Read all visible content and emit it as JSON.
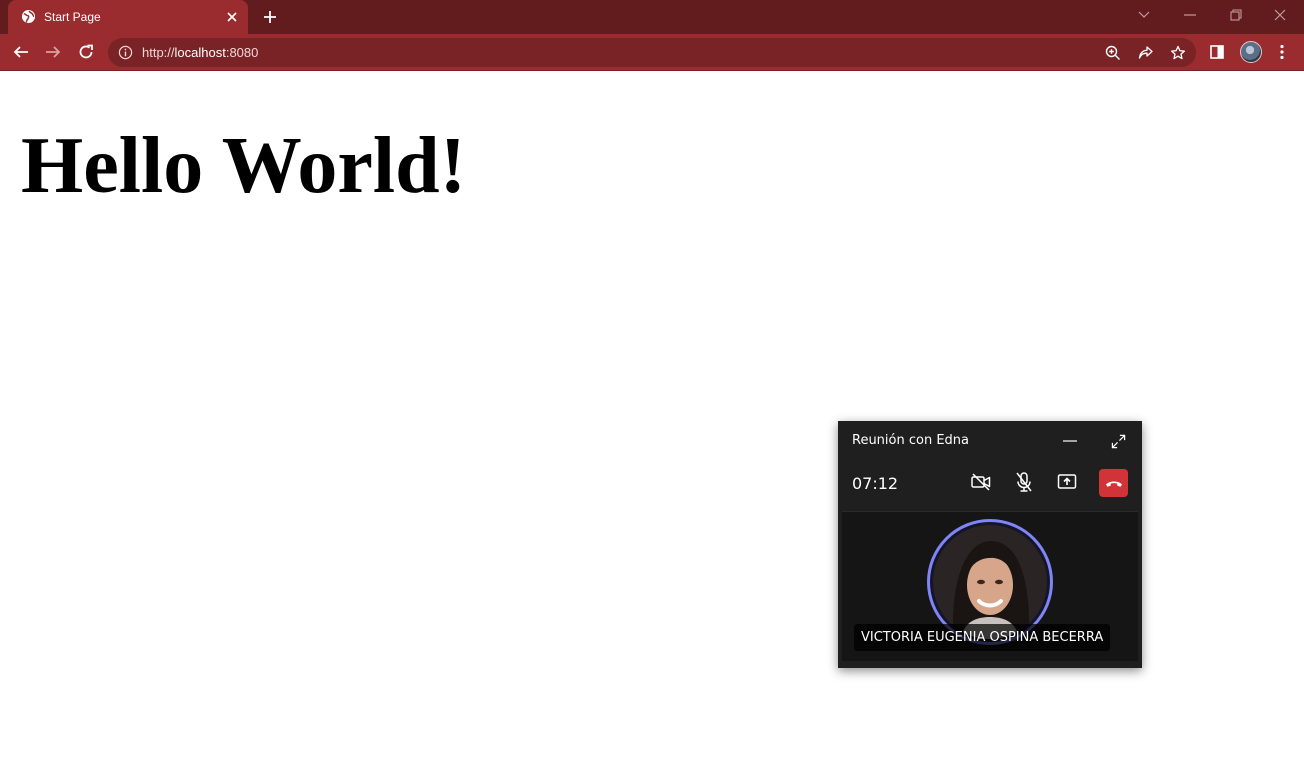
{
  "browser": {
    "tab": {
      "title": "Start Page"
    },
    "address": {
      "scheme": "http://",
      "host": "localhost",
      "port": ":8080"
    }
  },
  "page": {
    "heading": "Hello World!"
  },
  "call": {
    "title": "Reunión con Edna",
    "timer": "07:12",
    "participant": {
      "name": "VICTORIA EUGENIA OSPINA BECERRA"
    }
  },
  "colors": {
    "chrome_frame": "#631c1e",
    "chrome_toolbar": "#9a2b2f",
    "omnibox": "#7a2326",
    "call_background": "#1f1f1f",
    "hangup": "#d13438",
    "speaker_ring": "#7f85f5"
  },
  "icons": {
    "tab_favicon": "globe-icon",
    "tab_close": "close-icon",
    "new_tab": "plus-icon",
    "back": "arrow-left-icon",
    "forward": "arrow-right-icon",
    "reload": "reload-icon",
    "site_info": "info-icon",
    "zoom": "zoom-icon",
    "share": "share-icon",
    "bookmark": "star-icon",
    "side_panel": "side-panel-icon",
    "menu": "kebab-menu-icon",
    "camera_off": "video-off-icon",
    "mic_off": "mic-off-icon",
    "share_screen": "share-screen-icon",
    "hang_up": "phone-hangup-icon"
  }
}
